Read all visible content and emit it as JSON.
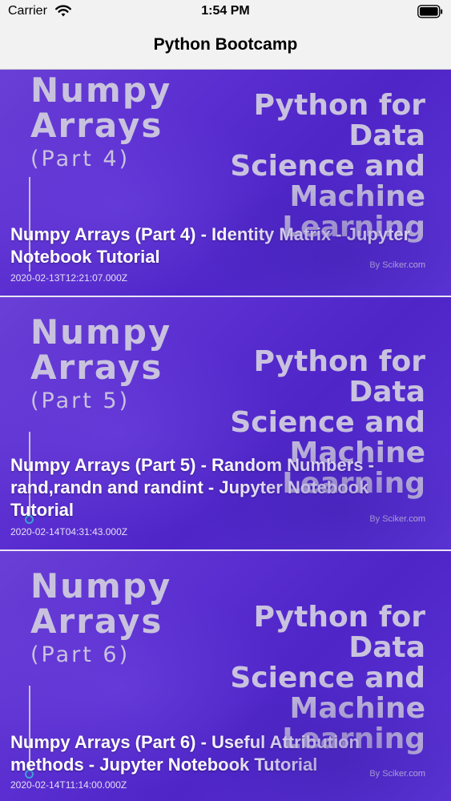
{
  "status_bar": {
    "carrier": "Carrier",
    "time": "1:54 PM"
  },
  "nav": {
    "title": "Python Bootcamp"
  },
  "videos": [
    {
      "thumb_topic": "Numpy",
      "thumb_topic_line2": "Arrays",
      "thumb_part": "(Part 4)",
      "thumb_series": "Python for Data Science and Machine Learning",
      "thumb_brand": "By Sciker.com",
      "title": "Numpy Arrays (Part 4) - Identity Matrix - Jupyter Notebook Tutorial",
      "date": "2020-02-13T12:21:07.000Z"
    },
    {
      "thumb_topic": "Numpy",
      "thumb_topic_line2": "Arrays",
      "thumb_part": "(Part 5)",
      "thumb_series": "Python for Data Science and Machine Learning",
      "thumb_brand": "By Sciker.com",
      "title": "Numpy Arrays (Part 5) - Random Numbers - rand,randn and randint - Jupyter Notebook Tutorial",
      "date": "2020-02-14T04:31:43.000Z"
    },
    {
      "thumb_topic": "Numpy",
      "thumb_topic_line2": "Arrays",
      "thumb_part": "(Part 6)",
      "thumb_series": "Python for Data Science and Machine Learning",
      "thumb_brand": "By Sciker.com",
      "title": "Numpy Arrays (Part 6) - Useful Attribution methods - Jupyter Notebook Tutorial",
      "date": "2020-02-14T11:14:00.000Z"
    }
  ]
}
